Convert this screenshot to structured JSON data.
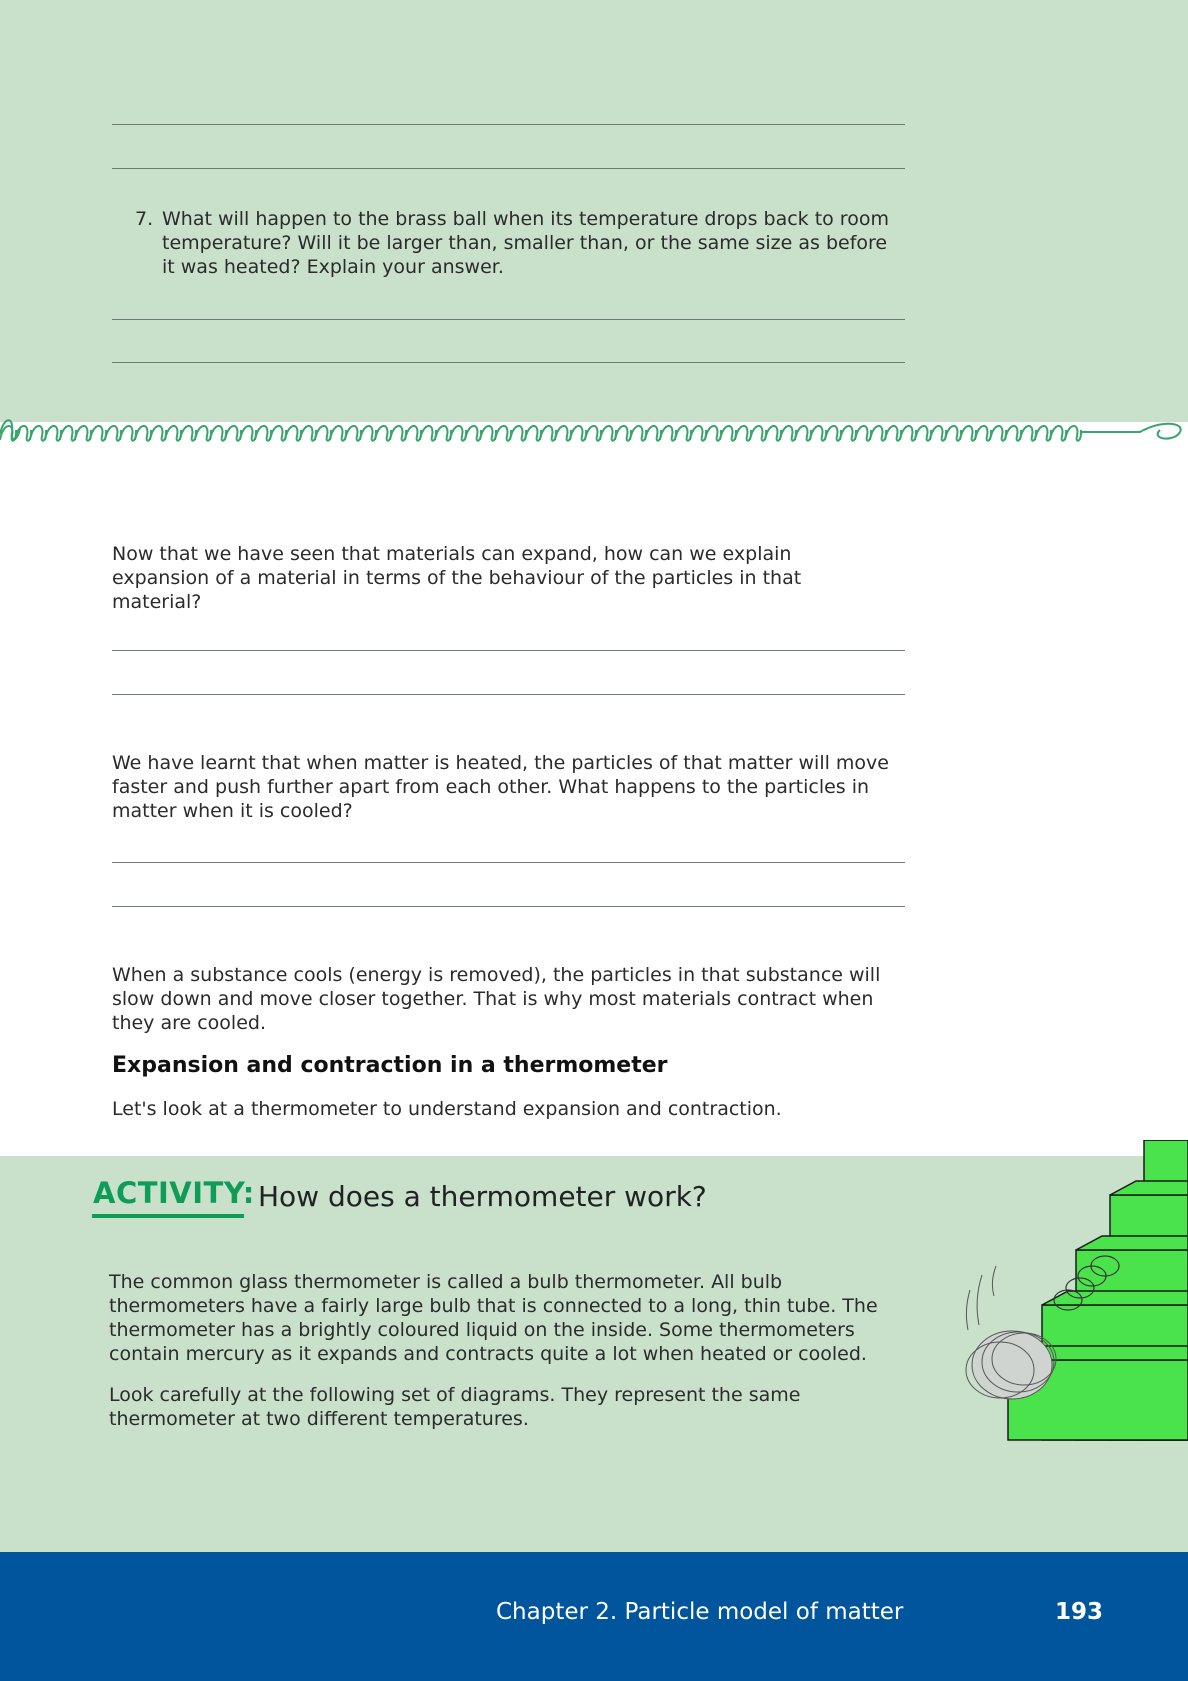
{
  "question7": {
    "number": "7.",
    "text": "What will happen to the brass ball when its temperature drops back to room temperature? Will it be larger than, smaller than, or the same size as before it was heated? Explain your answer."
  },
  "paragraphs": {
    "p1": "Now that we have seen that materials can expand, how can we explain expansion of a material in terms of the behaviour of the particles in that material?",
    "p2": "We have learnt that when matter is heated, the particles of that matter will move faster and push further apart from each other. What happens to the particles in matter when it is cooled?",
    "p3": "When a substance cools (energy is removed), the particles in that substance will slow down and move closer together. That is why most materials contract when they are cooled."
  },
  "section": {
    "heading": "Expansion and contraction in a thermometer",
    "intro": "Let's look at a thermometer to understand expansion and contraction."
  },
  "activity": {
    "label": "ACTIVITY:",
    "title": "How does a thermometer work?",
    "p1": "The common glass thermometer is called a bulb thermometer. All bulb thermometers have a fairly large bulb that is connected to a long, thin tube. The thermometer has a brightly coloured liquid on the inside. Some thermometers contain mercury as it expands and contracts quite a lot when heated or cooled.",
    "p2": "Look carefully at the following set of diagrams. They represent the same thermometer at two different temperatures."
  },
  "footer": {
    "chapter": "Chapter 2.  Particle model of matter",
    "page": "193"
  },
  "colors": {
    "activity_green": "#0f9b58",
    "panel_green": "#c9e0cb",
    "footer_blue": "#00559d"
  },
  "icons": [
    "spring-border-decoration",
    "slinky-on-stairs-illustration"
  ]
}
